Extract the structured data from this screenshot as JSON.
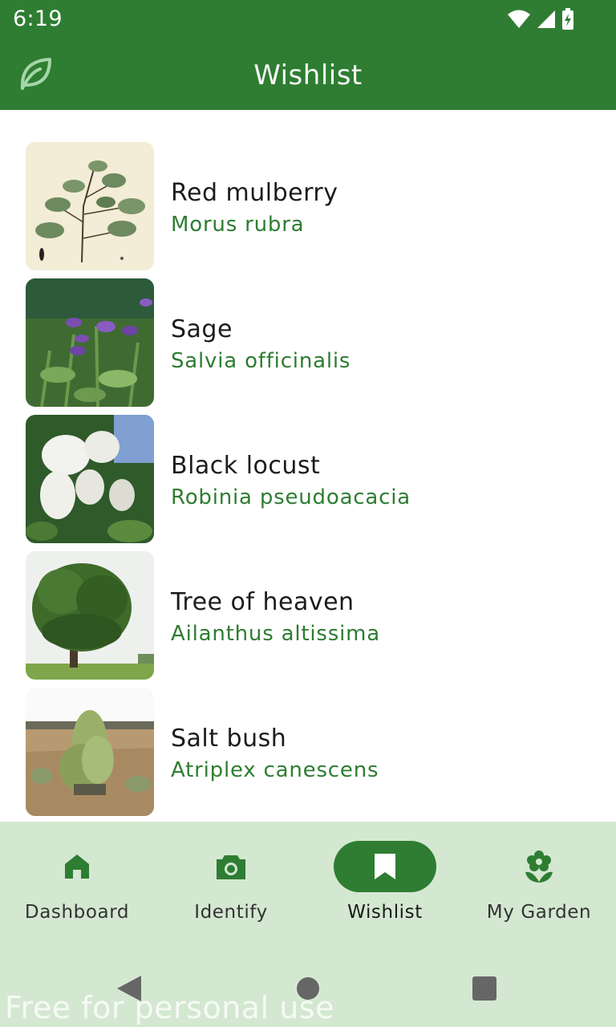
{
  "status_bar": {
    "time": "6:19"
  },
  "app_bar": {
    "title": "Wishlist",
    "logo_icon": "leaf-icon"
  },
  "plants": [
    {
      "name": "Red mulberry",
      "scientific": "Morus rubra"
    },
    {
      "name": "Sage",
      "scientific": "Salvia officinalis"
    },
    {
      "name": "Black locust",
      "scientific": "Robinia pseudoacacia"
    },
    {
      "name": "Tree of heaven",
      "scientific": "Ailanthus altissima"
    },
    {
      "name": "Salt bush",
      "scientific": "Atriplex canescens"
    }
  ],
  "bottom_nav": {
    "items": [
      {
        "label": "Dashboard",
        "icon": "home-icon",
        "active": false
      },
      {
        "label": "Identify",
        "icon": "camera-icon",
        "active": false
      },
      {
        "label": "Wishlist",
        "icon": "bookmark-icon",
        "active": true
      },
      {
        "label": "My Garden",
        "icon": "flower-icon",
        "active": false
      }
    ]
  },
  "watermark": "Free for personal use",
  "colors": {
    "primary": "#2e7d32",
    "nav_background": "#d4e8d1",
    "scientific_text": "#2e7d32"
  }
}
